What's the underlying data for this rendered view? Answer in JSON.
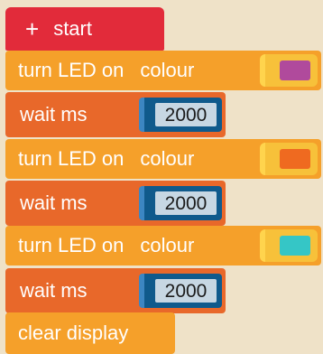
{
  "colors": {
    "background": "#efe2c8",
    "start_block": "#e22b3a",
    "led_block": "#f5a02a",
    "wait_block": "#e8682a",
    "number_socket": "#0f5a8c"
  },
  "start": {
    "icon": "plus-icon",
    "symbol": "+",
    "label": "start"
  },
  "blocks": [
    {
      "type": "turn-led",
      "label": "turn LED on",
      "colour_label": "colour",
      "swatch": "#b04a9c"
    },
    {
      "type": "wait",
      "label": "wait ms",
      "value": "2000"
    },
    {
      "type": "turn-led",
      "label": "turn LED on",
      "colour_label": "colour",
      "swatch": "#ef6a20"
    },
    {
      "type": "wait",
      "label": "wait ms",
      "value": "2000"
    },
    {
      "type": "turn-led",
      "label": "turn LED on",
      "colour_label": "colour",
      "swatch": "#35c6c6"
    },
    {
      "type": "wait",
      "label": "wait ms",
      "value": "2000"
    },
    {
      "type": "clear",
      "label": "clear display"
    }
  ]
}
